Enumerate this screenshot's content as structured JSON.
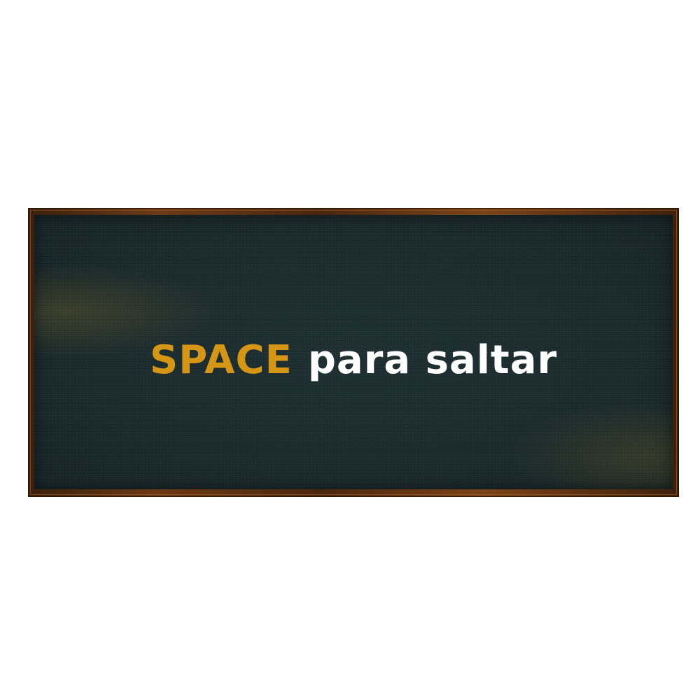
{
  "hint": {
    "key_label": "SPACE",
    "action_text": "para saltar"
  },
  "colors": {
    "key_highlight": "#d49614",
    "action_text": "#ffffff",
    "board_surface": "#1a2a2c",
    "frame_wood": "#5a3012",
    "background": "#ffffff"
  }
}
